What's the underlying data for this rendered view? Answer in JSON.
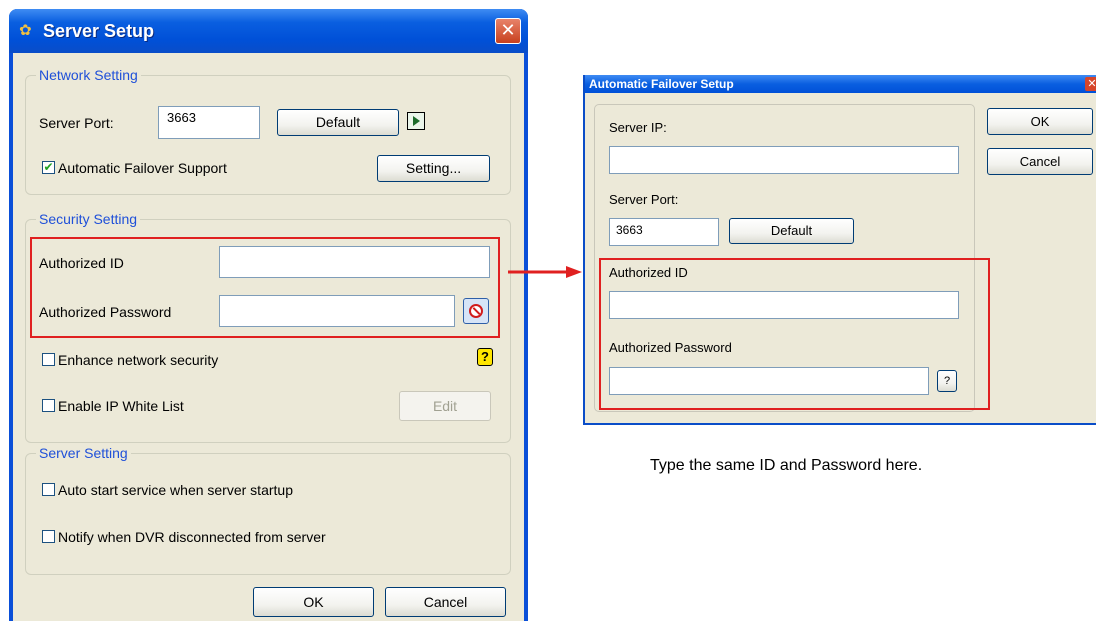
{
  "server_setup": {
    "title": "Server Setup",
    "close": "✕",
    "network": {
      "legend": "Network Setting",
      "server_port_label": "Server Port:",
      "server_port_value": "3663",
      "default_button": "Default",
      "failover_label": "Automatic Failover Support",
      "failover_checked": true,
      "setting_button": "Setting..."
    },
    "security": {
      "legend": "Security Setting",
      "authorized_id_label": "Authorized ID",
      "authorized_id_value": "",
      "authorized_password_label": "Authorized Password",
      "authorized_password_value": "",
      "enhance_label": "Enhance network security",
      "enhance_checked": false,
      "help_glyph": "?",
      "whitelist_label": "Enable IP White List",
      "whitelist_checked": false,
      "edit_button": "Edit"
    },
    "server": {
      "legend": "Server Setting",
      "autostart_label": "Auto start service when server startup",
      "autostart_checked": false,
      "notify_label": "Notify when DVR disconnected from server",
      "notify_checked": false
    },
    "ok_button": "OK",
    "cancel_button": "Cancel"
  },
  "failover_setup": {
    "title": "Automatic Failover Setup",
    "close": "✕",
    "server_ip_label": "Server IP:",
    "server_ip_value": "",
    "server_port_label": "Server Port:",
    "server_port_value": "3663",
    "default_button": "Default",
    "authorized_id_label": "Authorized ID",
    "authorized_id_value": "",
    "authorized_password_label": "Authorized Password",
    "authorized_password_value": "",
    "help_glyph": "?",
    "ok_button": "OK",
    "cancel_button": "Cancel"
  },
  "caption": "Type the same ID and Password here.",
  "colors": {
    "highlight": "#e02020",
    "title_blue": "#0050d8",
    "dialog_face": "#ece9d8",
    "legend_blue": "#1f50d9"
  }
}
